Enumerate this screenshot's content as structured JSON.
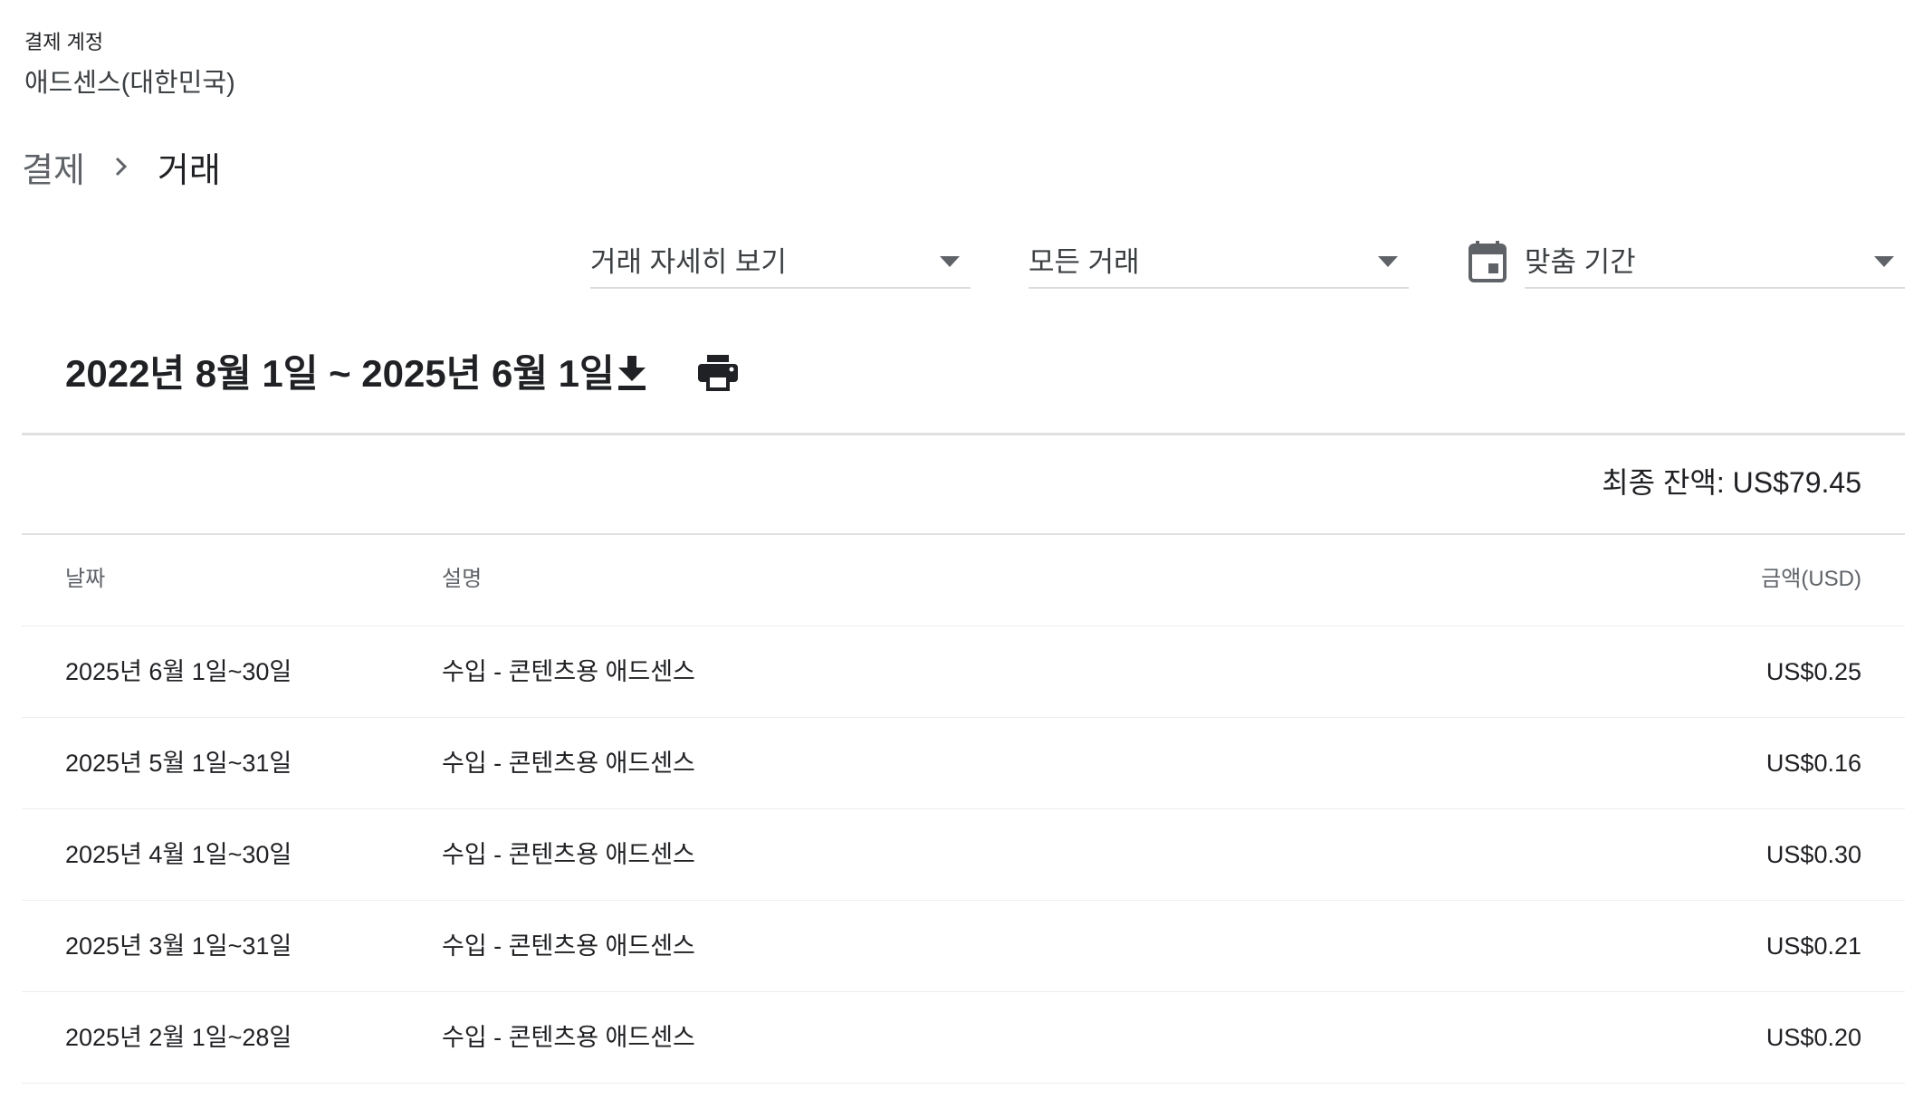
{
  "account": {
    "label": "결제 계정",
    "name": "애드센스(대한민국)"
  },
  "breadcrumb": {
    "parent": "결제",
    "current": "거래"
  },
  "filters": {
    "view": "거래 자세히 보기",
    "type": "모든 거래",
    "range": "맞춤 기간"
  },
  "date_range": "2022년 8월 1일 ~ 2025년 6월 1일",
  "balance": "최종 잔액: US$79.45",
  "table": {
    "headers": {
      "date": "날짜",
      "description": "설명",
      "amount": "금액(USD)"
    },
    "rows": [
      {
        "date": "2025년 6월 1일~30일",
        "description": "수입 - 콘텐츠용 애드센스",
        "amount": "US$0.25"
      },
      {
        "date": "2025년 5월 1일~31일",
        "description": "수입 - 콘텐츠용 애드센스",
        "amount": "US$0.16"
      },
      {
        "date": "2025년 4월 1일~30일",
        "description": "수입 - 콘텐츠용 애드센스",
        "amount": "US$0.30"
      },
      {
        "date": "2025년 3월 1일~31일",
        "description": "수입 - 콘텐츠용 애드센스",
        "amount": "US$0.21"
      },
      {
        "date": "2025년 2월 1일~28일",
        "description": "수입 - 콘텐츠용 애드센스",
        "amount": "US$0.20"
      }
    ]
  },
  "icons": {
    "separator": "chevron-right-icon",
    "dropdown": "arrow-drop-down-icon",
    "calendar": "calendar-icon",
    "download": "download-icon",
    "print": "print-icon"
  },
  "colors": {
    "text_primary": "#202124",
    "text_secondary": "#5f6368",
    "divider": "#e0e0e0",
    "icon": "#202124"
  }
}
